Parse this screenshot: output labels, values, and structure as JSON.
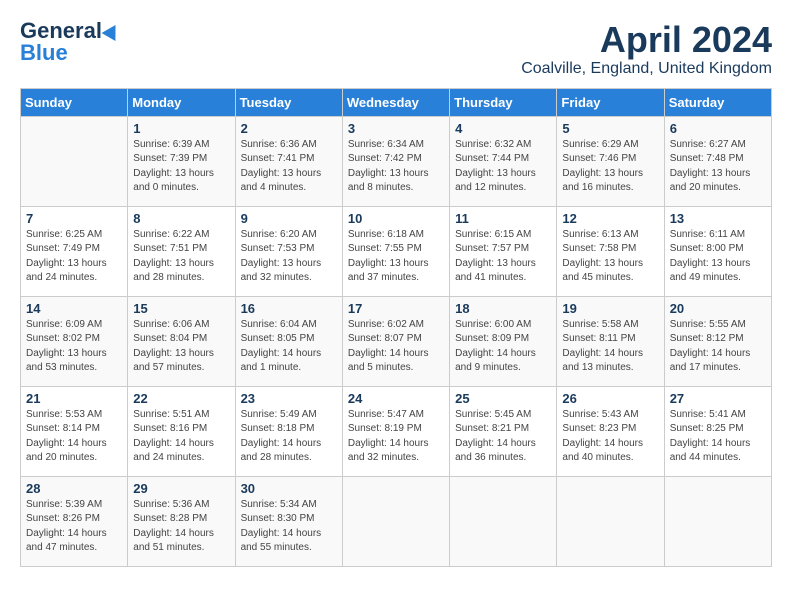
{
  "header": {
    "logo_general": "General",
    "logo_blue": "Blue",
    "month_title": "April 2024",
    "location": "Coalville, England, United Kingdom"
  },
  "weekdays": [
    "Sunday",
    "Monday",
    "Tuesday",
    "Wednesday",
    "Thursday",
    "Friday",
    "Saturday"
  ],
  "weeks": [
    [
      {
        "day": "",
        "sunrise": "",
        "sunset": "",
        "daylight": ""
      },
      {
        "day": "1",
        "sunrise": "Sunrise: 6:39 AM",
        "sunset": "Sunset: 7:39 PM",
        "daylight": "Daylight: 13 hours and 0 minutes."
      },
      {
        "day": "2",
        "sunrise": "Sunrise: 6:36 AM",
        "sunset": "Sunset: 7:41 PM",
        "daylight": "Daylight: 13 hours and 4 minutes."
      },
      {
        "day": "3",
        "sunrise": "Sunrise: 6:34 AM",
        "sunset": "Sunset: 7:42 PM",
        "daylight": "Daylight: 13 hours and 8 minutes."
      },
      {
        "day": "4",
        "sunrise": "Sunrise: 6:32 AM",
        "sunset": "Sunset: 7:44 PM",
        "daylight": "Daylight: 13 hours and 12 minutes."
      },
      {
        "day": "5",
        "sunrise": "Sunrise: 6:29 AM",
        "sunset": "Sunset: 7:46 PM",
        "daylight": "Daylight: 13 hours and 16 minutes."
      },
      {
        "day": "6",
        "sunrise": "Sunrise: 6:27 AM",
        "sunset": "Sunset: 7:48 PM",
        "daylight": "Daylight: 13 hours and 20 minutes."
      }
    ],
    [
      {
        "day": "7",
        "sunrise": "Sunrise: 6:25 AM",
        "sunset": "Sunset: 7:49 PM",
        "daylight": "Daylight: 13 hours and 24 minutes."
      },
      {
        "day": "8",
        "sunrise": "Sunrise: 6:22 AM",
        "sunset": "Sunset: 7:51 PM",
        "daylight": "Daylight: 13 hours and 28 minutes."
      },
      {
        "day": "9",
        "sunrise": "Sunrise: 6:20 AM",
        "sunset": "Sunset: 7:53 PM",
        "daylight": "Daylight: 13 hours and 32 minutes."
      },
      {
        "day": "10",
        "sunrise": "Sunrise: 6:18 AM",
        "sunset": "Sunset: 7:55 PM",
        "daylight": "Daylight: 13 hours and 37 minutes."
      },
      {
        "day": "11",
        "sunrise": "Sunrise: 6:15 AM",
        "sunset": "Sunset: 7:57 PM",
        "daylight": "Daylight: 13 hours and 41 minutes."
      },
      {
        "day": "12",
        "sunrise": "Sunrise: 6:13 AM",
        "sunset": "Sunset: 7:58 PM",
        "daylight": "Daylight: 13 hours and 45 minutes."
      },
      {
        "day": "13",
        "sunrise": "Sunrise: 6:11 AM",
        "sunset": "Sunset: 8:00 PM",
        "daylight": "Daylight: 13 hours and 49 minutes."
      }
    ],
    [
      {
        "day": "14",
        "sunrise": "Sunrise: 6:09 AM",
        "sunset": "Sunset: 8:02 PM",
        "daylight": "Daylight: 13 hours and 53 minutes."
      },
      {
        "day": "15",
        "sunrise": "Sunrise: 6:06 AM",
        "sunset": "Sunset: 8:04 PM",
        "daylight": "Daylight: 13 hours and 57 minutes."
      },
      {
        "day": "16",
        "sunrise": "Sunrise: 6:04 AM",
        "sunset": "Sunset: 8:05 PM",
        "daylight": "Daylight: 14 hours and 1 minute."
      },
      {
        "day": "17",
        "sunrise": "Sunrise: 6:02 AM",
        "sunset": "Sunset: 8:07 PM",
        "daylight": "Daylight: 14 hours and 5 minutes."
      },
      {
        "day": "18",
        "sunrise": "Sunrise: 6:00 AM",
        "sunset": "Sunset: 8:09 PM",
        "daylight": "Daylight: 14 hours and 9 minutes."
      },
      {
        "day": "19",
        "sunrise": "Sunrise: 5:58 AM",
        "sunset": "Sunset: 8:11 PM",
        "daylight": "Daylight: 14 hours and 13 minutes."
      },
      {
        "day": "20",
        "sunrise": "Sunrise: 5:55 AM",
        "sunset": "Sunset: 8:12 PM",
        "daylight": "Daylight: 14 hours and 17 minutes."
      }
    ],
    [
      {
        "day": "21",
        "sunrise": "Sunrise: 5:53 AM",
        "sunset": "Sunset: 8:14 PM",
        "daylight": "Daylight: 14 hours and 20 minutes."
      },
      {
        "day": "22",
        "sunrise": "Sunrise: 5:51 AM",
        "sunset": "Sunset: 8:16 PM",
        "daylight": "Daylight: 14 hours and 24 minutes."
      },
      {
        "day": "23",
        "sunrise": "Sunrise: 5:49 AM",
        "sunset": "Sunset: 8:18 PM",
        "daylight": "Daylight: 14 hours and 28 minutes."
      },
      {
        "day": "24",
        "sunrise": "Sunrise: 5:47 AM",
        "sunset": "Sunset: 8:19 PM",
        "daylight": "Daylight: 14 hours and 32 minutes."
      },
      {
        "day": "25",
        "sunrise": "Sunrise: 5:45 AM",
        "sunset": "Sunset: 8:21 PM",
        "daylight": "Daylight: 14 hours and 36 minutes."
      },
      {
        "day": "26",
        "sunrise": "Sunrise: 5:43 AM",
        "sunset": "Sunset: 8:23 PM",
        "daylight": "Daylight: 14 hours and 40 minutes."
      },
      {
        "day": "27",
        "sunrise": "Sunrise: 5:41 AM",
        "sunset": "Sunset: 8:25 PM",
        "daylight": "Daylight: 14 hours and 44 minutes."
      }
    ],
    [
      {
        "day": "28",
        "sunrise": "Sunrise: 5:39 AM",
        "sunset": "Sunset: 8:26 PM",
        "daylight": "Daylight: 14 hours and 47 minutes."
      },
      {
        "day": "29",
        "sunrise": "Sunrise: 5:36 AM",
        "sunset": "Sunset: 8:28 PM",
        "daylight": "Daylight: 14 hours and 51 minutes."
      },
      {
        "day": "30",
        "sunrise": "Sunrise: 5:34 AM",
        "sunset": "Sunset: 8:30 PM",
        "daylight": "Daylight: 14 hours and 55 minutes."
      },
      {
        "day": "",
        "sunrise": "",
        "sunset": "",
        "daylight": ""
      },
      {
        "day": "",
        "sunrise": "",
        "sunset": "",
        "daylight": ""
      },
      {
        "day": "",
        "sunrise": "",
        "sunset": "",
        "daylight": ""
      },
      {
        "day": "",
        "sunrise": "",
        "sunset": "",
        "daylight": ""
      }
    ]
  ]
}
